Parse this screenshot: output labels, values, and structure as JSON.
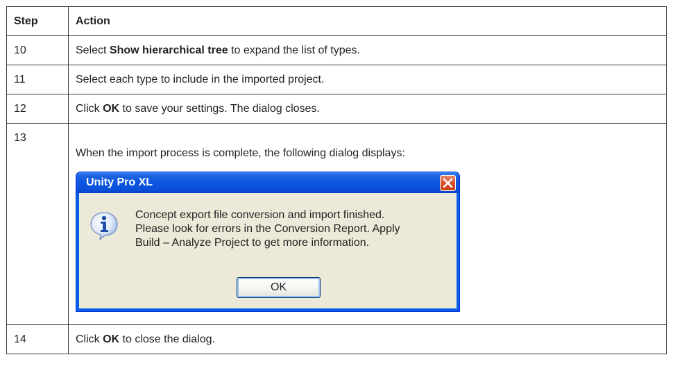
{
  "table": {
    "header": {
      "step": "Step",
      "action": "Action"
    },
    "rows": [
      {
        "step": "10",
        "pre": "Select ",
        "bold": "Show hierarchical tree",
        "post": " to expand the list of types."
      },
      {
        "step": "11",
        "text": "Select each type to include in the imported project."
      },
      {
        "step": "12",
        "pre": "Click ",
        "bold": "OK",
        "post": " to save your settings. The dialog closes."
      },
      {
        "step": "13",
        "text": "When the import process is complete, the following dialog displays:"
      },
      {
        "step": "14",
        "pre": "Click ",
        "bold": "OK",
        "post": " to close the dialog."
      }
    ]
  },
  "dialog": {
    "title": "Unity Pro XL",
    "message_lines": [
      "Concept export file conversion and import finished.",
      "Please look for errors in the Conversion Report. Apply",
      "Build – Analyze Project to get more information."
    ],
    "ok_label": "OK",
    "icons": {
      "info": "info-icon",
      "close": "close-icon"
    },
    "colors": {
      "titlebar": "#0a55e1",
      "body": "#ece9d8",
      "close": "#d9502b"
    }
  }
}
